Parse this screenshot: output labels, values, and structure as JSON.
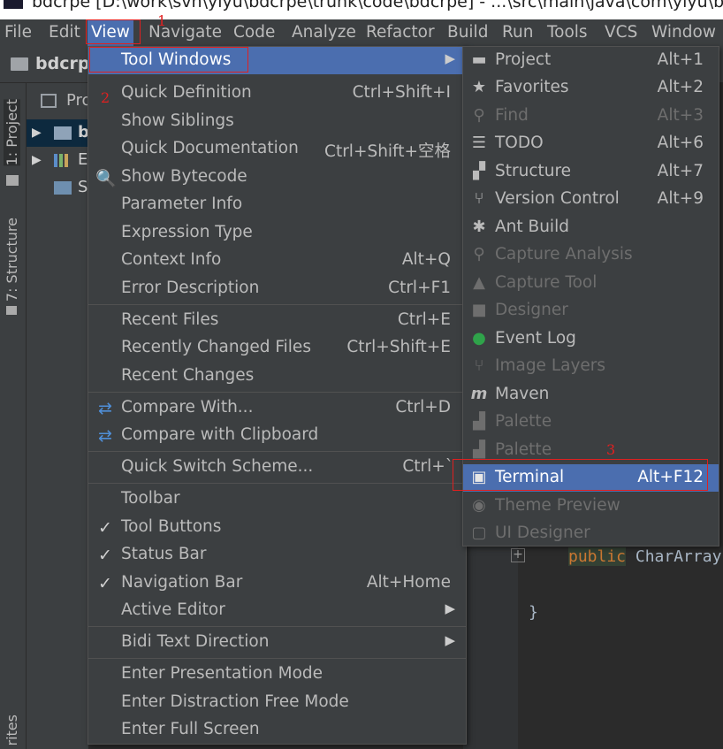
{
  "title_bar": {
    "text": "bdcrpe [D:\\work\\svn\\yiyu\\bdcrpe\\trunk\\code\\bdcrpe] - ...\\src\\main\\java\\com\\yiyu\\bdcrpe\\b"
  },
  "menu_bar": {
    "items": [
      "File",
      "Edit",
      "View",
      "Navigate",
      "Code",
      "Analyze",
      "Refactor",
      "Build",
      "Run",
      "Tools",
      "VCS",
      "Window"
    ]
  },
  "nav_bar": {
    "project_name": "bdcrpe"
  },
  "left_strip": {
    "project_tab": "1: Project",
    "structure_tab": "7: Structure",
    "favorites_tab": "rites"
  },
  "project_panel": {
    "header_label": "Pro",
    "rows": [
      {
        "text": "b"
      },
      {
        "text": "E"
      },
      {
        "text": "S"
      }
    ]
  },
  "editor": {
    "line1_keyword": "public",
    "line1_rest": " CharArray",
    "line2": "}"
  },
  "view_menu": {
    "items": [
      {
        "label": "Tool Windows",
        "shortcut": "",
        "submenu": true
      },
      {
        "label": "Quick Definition",
        "shortcut": "Ctrl+Shift+I"
      },
      {
        "label": "Show Siblings",
        "shortcut": ""
      },
      {
        "label": "Quick Documentation",
        "shortcut": "Ctrl+Shift+空格"
      },
      {
        "label": "Show Bytecode",
        "shortcut": "",
        "icon": "bytecode-icon"
      },
      {
        "label": "Parameter Info",
        "shortcut": ""
      },
      {
        "label": "Expression Type",
        "shortcut": ""
      },
      {
        "label": "Context Info",
        "shortcut": "Alt+Q"
      },
      {
        "label": "Error Description",
        "shortcut": "Ctrl+F1"
      },
      {
        "label": "Recent Files",
        "shortcut": "Ctrl+E"
      },
      {
        "label": "Recently Changed Files",
        "shortcut": "Ctrl+Shift+E"
      },
      {
        "label": "Recent Changes",
        "shortcut": ""
      },
      {
        "label": "Compare With...",
        "shortcut": "Ctrl+D",
        "icon": "compare-icon"
      },
      {
        "label": "Compare with Clipboard",
        "shortcut": "",
        "icon": "compare-clipboard-icon"
      },
      {
        "label": "Quick Switch Scheme...",
        "shortcut": "Ctrl+`"
      },
      {
        "label": "Toolbar",
        "shortcut": ""
      },
      {
        "label": "Tool Buttons",
        "shortcut": "",
        "checked": true
      },
      {
        "label": "Status Bar",
        "shortcut": "",
        "checked": true
      },
      {
        "label": "Navigation Bar",
        "shortcut": "Alt+Home",
        "checked": true
      },
      {
        "label": "Active Editor",
        "shortcut": "",
        "submenu": true
      },
      {
        "label": "Bidi Text Direction",
        "shortcut": "",
        "submenu": true
      },
      {
        "label": "Enter Presentation Mode",
        "shortcut": ""
      },
      {
        "label": "Enter Distraction Free Mode",
        "shortcut": ""
      },
      {
        "label": "Enter Full Screen",
        "shortcut": ""
      }
    ],
    "check_glyph": "✓",
    "submenu_glyph": "▶"
  },
  "tool_windows_submenu": {
    "items": [
      {
        "label": "Project",
        "shortcut": "Alt+1",
        "icon": "folder-icon",
        "enabled": true
      },
      {
        "label": "Favorites",
        "shortcut": "Alt+2",
        "icon": "star-icon",
        "enabled": true
      },
      {
        "label": "Find",
        "shortcut": "Alt+3",
        "icon": "find-icon",
        "enabled": false
      },
      {
        "label": "TODO",
        "shortcut": "Alt+6",
        "icon": "todo-icon",
        "enabled": true
      },
      {
        "label": "Structure",
        "shortcut": "Alt+7",
        "icon": "structure-icon",
        "enabled": true
      },
      {
        "label": "Version Control",
        "shortcut": "Alt+9",
        "icon": "version-control-icon",
        "enabled": true
      },
      {
        "label": "Ant Build",
        "shortcut": "",
        "icon": "ant-icon",
        "enabled": true
      },
      {
        "label": "Capture Analysis",
        "shortcut": "",
        "icon": "capture-analysis-icon",
        "enabled": false
      },
      {
        "label": "Capture Tool",
        "shortcut": "",
        "icon": "capture-tool-icon",
        "enabled": false
      },
      {
        "label": "Designer",
        "shortcut": "",
        "icon": "designer-icon",
        "enabled": false
      },
      {
        "label": "Event Log",
        "shortcut": "",
        "icon": "event-log-icon",
        "enabled": true
      },
      {
        "label": "Image Layers",
        "shortcut": "",
        "icon": "image-layers-icon",
        "enabled": false
      },
      {
        "label": "Maven",
        "shortcut": "",
        "icon": "maven-icon",
        "enabled": true
      },
      {
        "label": "Palette",
        "shortcut": "",
        "icon": "palette-icon",
        "enabled": false
      },
      {
        "label": "Palette",
        "shortcut": "",
        "icon": "palette-icon",
        "enabled": false
      },
      {
        "label": "Terminal",
        "shortcut": "Alt+F12",
        "icon": "terminal-icon",
        "enabled": true
      },
      {
        "label": "Theme Preview",
        "shortcut": "",
        "icon": "theme-preview-icon",
        "enabled": false
      },
      {
        "label": "UI Designer",
        "shortcut": "",
        "icon": "ui-designer-icon",
        "enabled": false
      }
    ]
  },
  "annotations": {
    "step1": "1",
    "step2": "2",
    "step3": "3"
  },
  "colors": {
    "accent": "#4b6eaf",
    "menu_bg": "#3c3f41",
    "annotation": "#e02020",
    "event_log": "#2fa34a"
  }
}
